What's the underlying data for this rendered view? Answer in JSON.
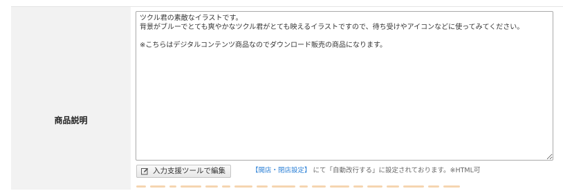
{
  "field": {
    "label": "商品説明",
    "description_value": "ツクル君の素敵なイラストです。\n背景がブルーでとても爽やかなツクル君がとても映えるイラストですので、待ち受けやアイコンなどに使ってみてください。\n\n※こちらはデジタルコンテンツ商品なのでダウンロード販売の商品になります。"
  },
  "editor_button": {
    "label": "入力支援ツールで編集",
    "icon": "edit-icon"
  },
  "note": {
    "link": "【開店・閉店設定】",
    "text": "にて「自動改行する」に設定されております。※HTML可"
  },
  "colors": {
    "label_bg": "#f2f2f2",
    "link": "#2a7fd6",
    "accent": "#e38a1f"
  }
}
